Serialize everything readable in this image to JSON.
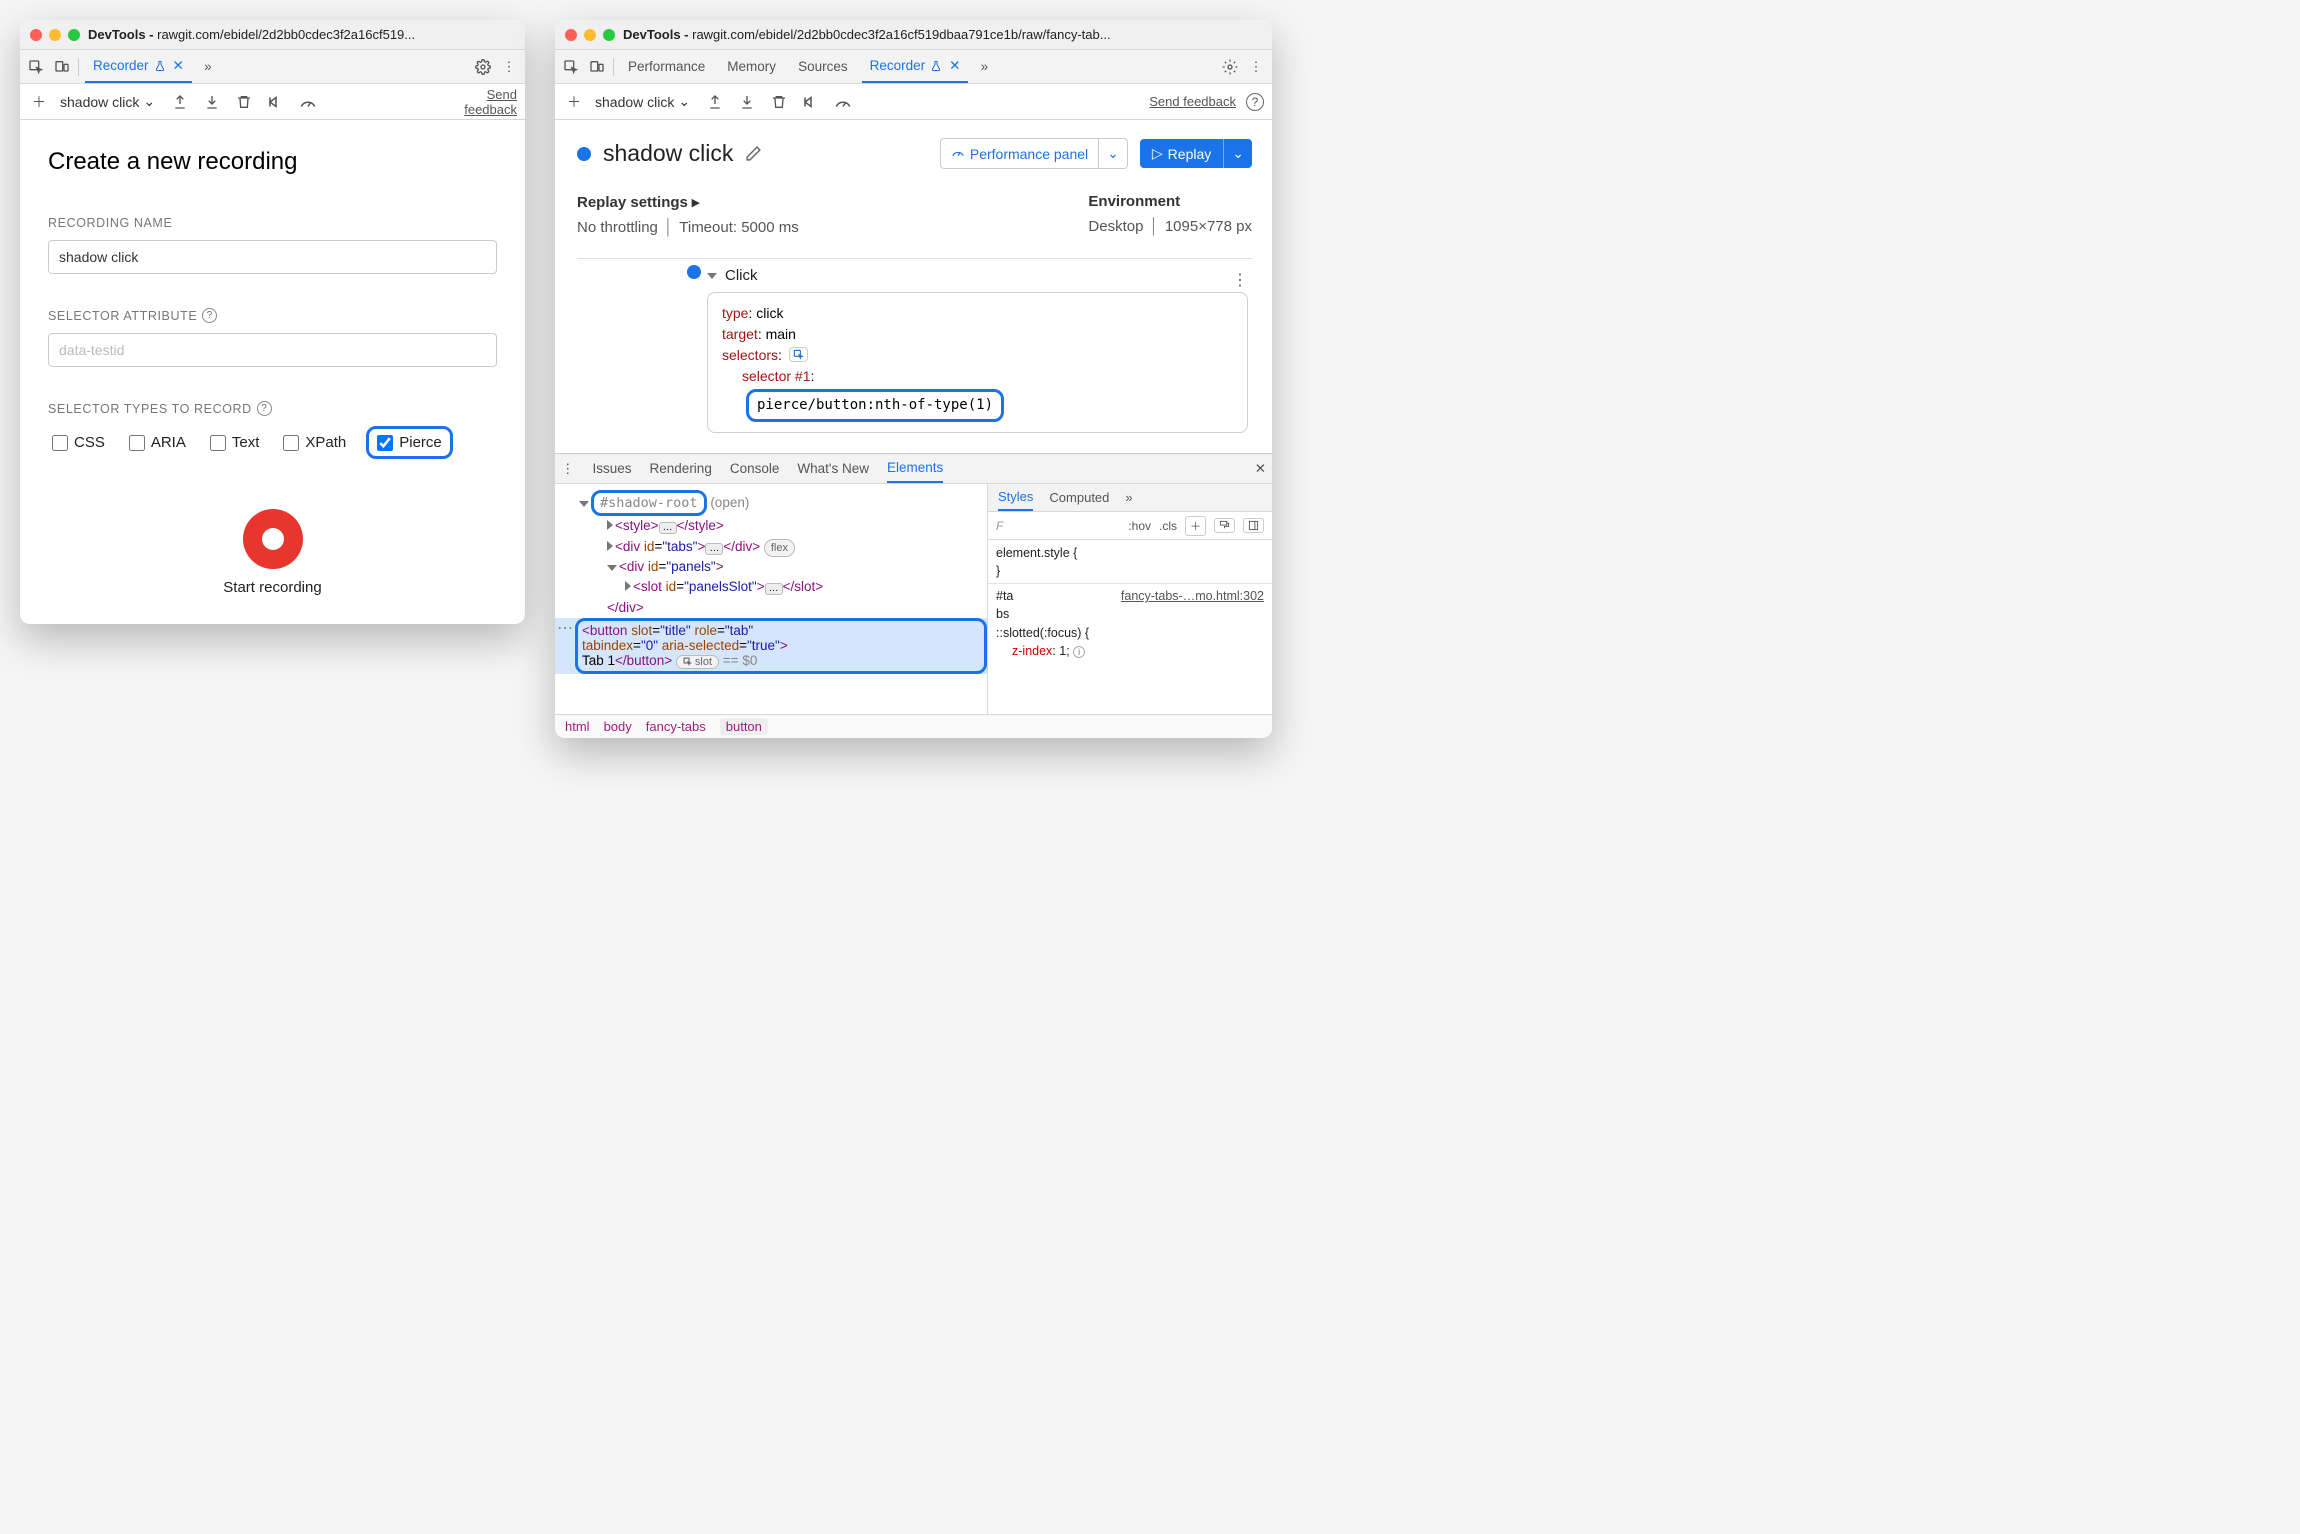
{
  "left": {
    "title_prefix": "DevTools - ",
    "title_url": "rawgit.com/ebidel/2d2bb0cdec3f2a16cf519...",
    "tabs": {
      "recorder": "Recorder"
    },
    "toolbar": {
      "recording_name": "shadow click",
      "feedback_label": "Send feedback"
    },
    "form": {
      "heading": "Create a new recording",
      "name_label": "RECORDING NAME",
      "name_value": "shadow click",
      "attr_label": "SELECTOR ATTRIBUTE",
      "attr_placeholder": "data-testid",
      "types_label": "SELECTOR TYPES TO RECORD",
      "types": {
        "css": "CSS",
        "aria": "ARIA",
        "text": "Text",
        "xpath": "XPath",
        "pierce": "Pierce"
      },
      "start_label": "Start recording"
    }
  },
  "right": {
    "title_prefix": "DevTools - ",
    "title_url": "rawgit.com/ebidel/2d2bb0cdec3f2a16cf519dbaa791ce1b/raw/fancy-tab...",
    "tabs": {
      "performance": "Performance",
      "memory": "Memory",
      "sources": "Sources",
      "recorder": "Recorder"
    },
    "toolbar": {
      "recording_name": "shadow click",
      "feedback_label": "Send feedback"
    },
    "workspace": {
      "title": "shadow click",
      "perf_panel_btn": "Performance panel",
      "replay_btn": "Replay",
      "replay_settings_label": "Replay settings",
      "throttling": "No throttling",
      "timeout": "Timeout: 5000 ms",
      "env_label": "Environment",
      "env_device": "Desktop",
      "env_viewport": "1095×778 px",
      "step": {
        "name": "Click",
        "kv": {
          "type_k": "type",
          "type_v": "click",
          "target_k": "target",
          "target_v": "main",
          "selectors_k": "selectors",
          "sel1_k": "selector #1",
          "sel1_v": "pierce/button:nth-of-type(1)"
        }
      }
    },
    "drawer": {
      "tabs": {
        "issues": "Issues",
        "rendering": "Rendering",
        "console": "Console",
        "whatsnew": "What's New",
        "elements": "Elements"
      },
      "dom": {
        "shadow_root": "#shadow-root",
        "shadow_open": "(open)",
        "style": "<style>",
        "style_close": "</style>",
        "div_tabs": "<div id=\"tabs\">",
        "div_close": "</div>",
        "flex": "flex",
        "div_panels": "<div id=\"panels\">",
        "slot_panels": "<slot id=\"panelsSlot\">",
        "slot_close": "</slot>",
        "button_open": "<button slot=\"title\" role=\"tab\" tabindex=\"0\" aria-selected=\"true\">",
        "button_text_close": "Tab 1</button>",
        "slot_pill": "slot",
        "eq0": " == $0"
      },
      "styles": {
        "tabs": {
          "styles": "Styles",
          "computed": "Computed"
        },
        "filter_chars": "F",
        "hov": ":hov",
        "cls": ".cls",
        "element_style_open": "element.style {",
        "close_brace": "}",
        "rule_sel": "#ta\nbs",
        "src": "fancy-tabs-…mo.html:302",
        "slotted": "::slotted(:focus) {",
        "zindex_k": "z-index",
        "zindex_v": "1"
      },
      "crumbs": [
        "html",
        "body",
        "fancy-tabs",
        "button"
      ]
    }
  }
}
